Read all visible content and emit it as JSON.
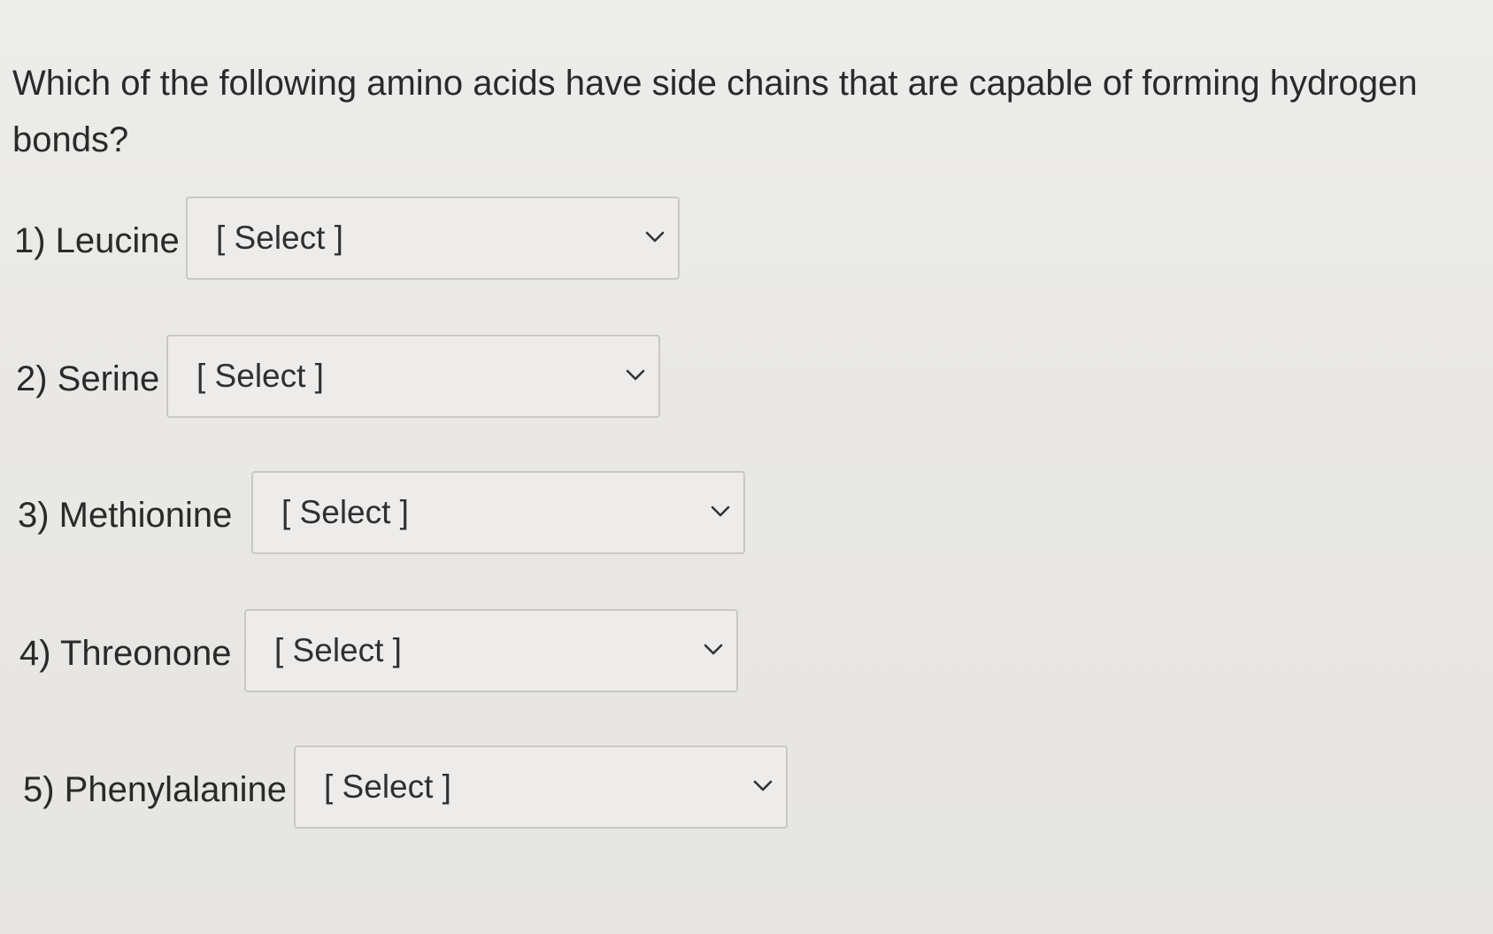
{
  "question": {
    "text": "Which of the following amino acids have side chains that are capable of forming hydrogen bonds?"
  },
  "items": [
    {
      "label": "1) Leucine",
      "selected": "[ Select ]"
    },
    {
      "label": "2) Serine",
      "selected": "[ Select ]"
    },
    {
      "label": "3) Methionine",
      "selected": "[ Select ]"
    },
    {
      "label": "4) Threonone",
      "selected": "[ Select ]"
    },
    {
      "label": "5) Phenylalanine",
      "selected": "[ Select ]"
    }
  ],
  "icons": {
    "dropdown": "chevron-down-icon"
  },
  "colors": {
    "background": "#e9e8e5",
    "text": "#2a2a2a",
    "border": "#c9c8c4"
  }
}
